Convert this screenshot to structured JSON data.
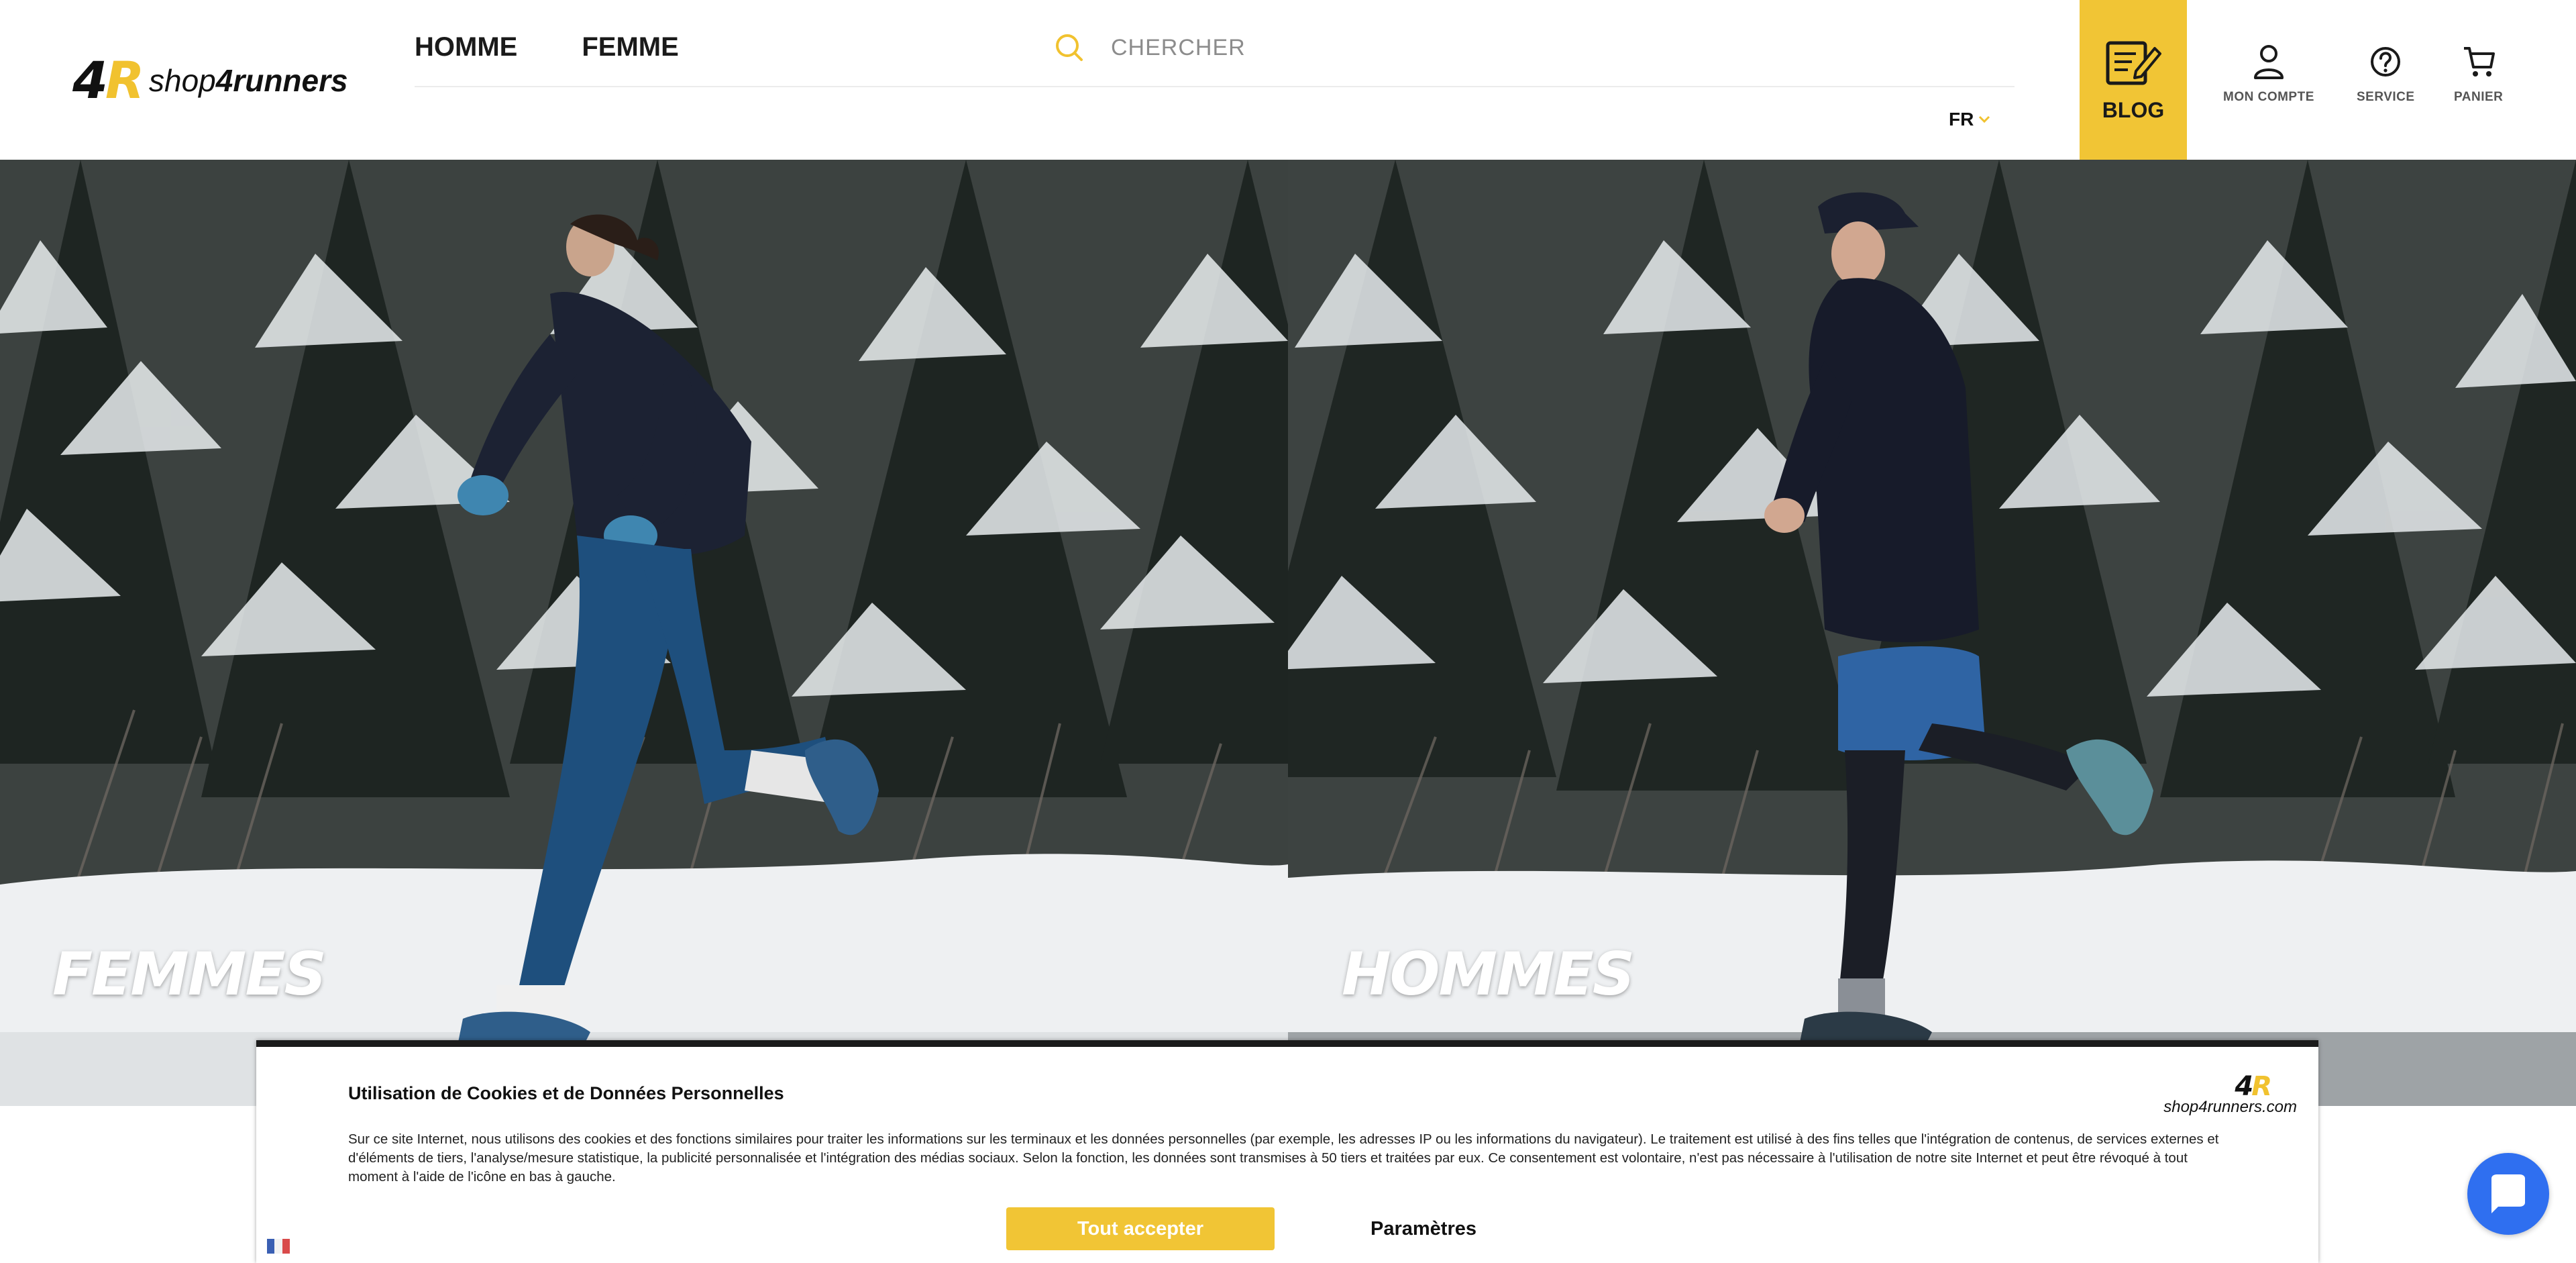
{
  "brand": {
    "mark_four": "4",
    "mark_r": "R",
    "name_light": "shop",
    "name_bold": "4runners",
    "cookie_name": "shop4runners.com"
  },
  "nav": {
    "items": [
      {
        "label": "HOMME"
      },
      {
        "label": "FEMME"
      }
    ]
  },
  "search": {
    "placeholder": "CHERCHER",
    "value": ""
  },
  "language": {
    "selected": "FR"
  },
  "blog": {
    "label": "BLOG"
  },
  "utility": {
    "account": "MON COMPTE",
    "service": "SERVICE",
    "cart": "PANIER"
  },
  "hero": {
    "left_label": "FEMMES",
    "right_label": "HOMMES"
  },
  "cookie": {
    "title": "Utilisation de Cookies et de Données Personnelles",
    "body": "Sur ce site Internet, nous utilisons des cookies et des fonctions similaires pour traiter les informations sur les terminaux et les données personnelles (par exemple, les adresses IP ou les informations du navigateur). Le traitement est utilisé à des fins telles que l'intégration de contenus, de services externes et d'éléments de tiers, l'analyse/mesure statistique, la publicité personnalisée et l'intégration des médias sociaux. Selon la fonction, les données sont transmises à 50 tiers et traitées par eux. Ce consentement est volontaire, n'est pas nécessaire à l'utilisation de notre site Internet et peut être révoqué à tout moment à l'aide de l'icône en bas à gauche.",
    "accept_label": "Tout accepter",
    "settings_label": "Paramètres"
  },
  "colors": {
    "accent": "#f1c535",
    "chat": "#2f6ff0",
    "text": "#1a1a1a"
  },
  "icons": [
    "search-icon",
    "chevron-down-icon",
    "blog-edit-icon",
    "user-icon",
    "help-circle-icon",
    "cart-icon",
    "flag-icon",
    "chat-icon"
  ]
}
